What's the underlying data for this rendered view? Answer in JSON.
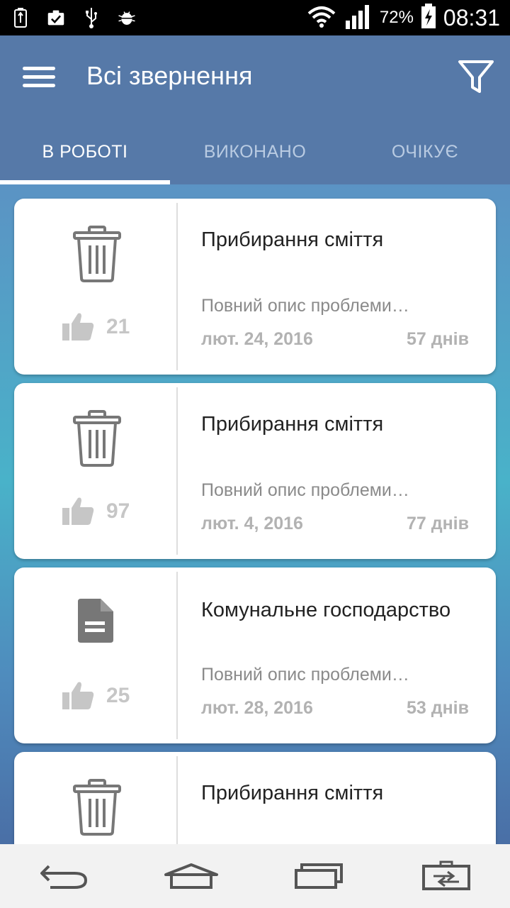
{
  "status_bar": {
    "battery_percent": "72%",
    "time": "08:31",
    "icons": [
      "battery-charging-icon",
      "clipboard-check-icon",
      "usb-icon",
      "android-debug-icon",
      "wifi-icon",
      "signal-icon",
      "battery-icon"
    ]
  },
  "app_bar": {
    "title": "Всі звернення",
    "background_color": "#5679a8"
  },
  "tabs": [
    {
      "label": "В РОБОТІ",
      "active": true
    },
    {
      "label": "ВИКОНАНО",
      "active": false
    },
    {
      "label": "ОЧІКУЄ",
      "active": false
    }
  ],
  "cards": [
    {
      "icon": "trash-icon",
      "likes": "21",
      "title": "Прибирання сміття",
      "description": "Повний опис проблеми…",
      "date": "лют. 24, 2016",
      "days": "57 днів"
    },
    {
      "icon": "trash-icon",
      "likes": "97",
      "title": "Прибирання сміття",
      "description": "Повний опис проблеми…",
      "date": "лют. 4, 2016",
      "days": "77 днів"
    },
    {
      "icon": "document-icon",
      "likes": "25",
      "title": "Комунальне господарство",
      "description": "Повний опис проблеми…",
      "date": "лют. 28, 2016",
      "days": "53 днів"
    },
    {
      "icon": "trash-icon",
      "title": "Прибирання сміття"
    }
  ],
  "nav_bar": {
    "icons": [
      "back-icon",
      "home-icon",
      "recent-apps-icon",
      "dual-window-icon"
    ]
  }
}
